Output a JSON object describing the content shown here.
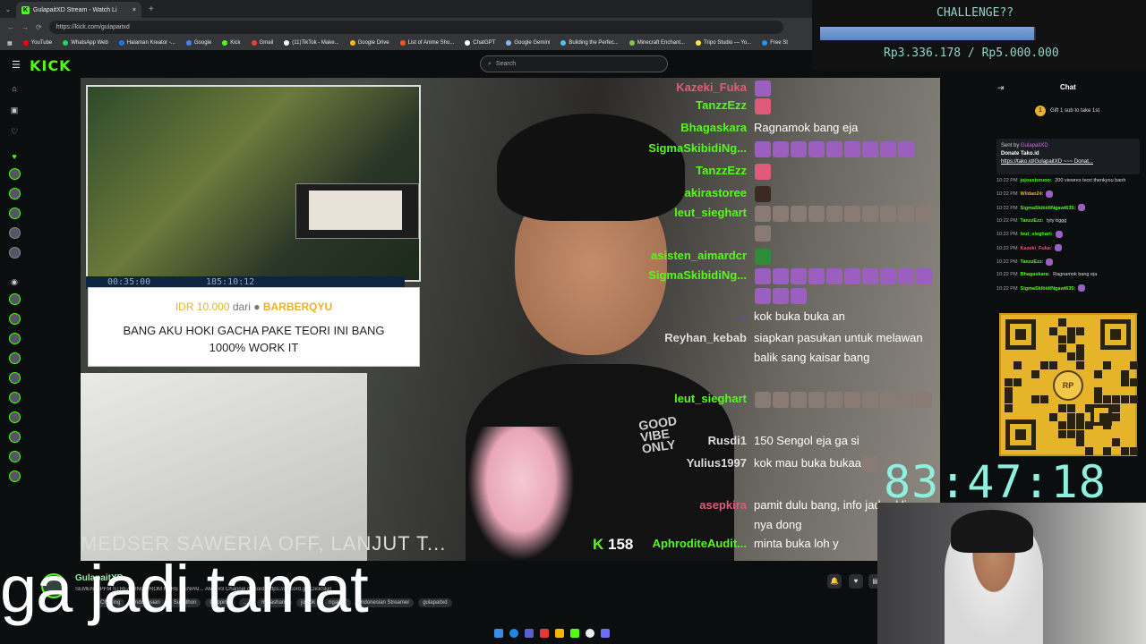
{
  "browser": {
    "tab_title": "GulapaitXD Stream - Watch Li",
    "url": "https://kick.com/gulapaitxd",
    "bookmarks": [
      {
        "label": "YouTube",
        "color": "#ff0000"
      },
      {
        "label": "WhatsApp Web",
        "color": "#25d366"
      },
      {
        "label": "Halaman Kreator -...",
        "color": "#1877f2"
      },
      {
        "label": "Google",
        "color": "#4285f4"
      },
      {
        "label": "Kick",
        "color": "#53fc18"
      },
      {
        "label": "Gmail",
        "color": "#ea4335"
      },
      {
        "label": "(11)TikTok - Make...",
        "color": "#ffffff"
      },
      {
        "label": "Google Drive",
        "color": "#fbbc04"
      },
      {
        "label": "List of Anime Sho...",
        "color": "#ff5722"
      },
      {
        "label": "ChatGPT",
        "color": "#ffffff"
      },
      {
        "label": "Google Gemini",
        "color": "#8ab4f8"
      },
      {
        "label": "Building the Perfec...",
        "color": "#4fc3f7"
      },
      {
        "label": "Minecraft Enchant...",
        "color": "#8bc34a"
      },
      {
        "label": "Tripo Studio — Yo...",
        "color": "#ffeb3b"
      },
      {
        "label": "Free St",
        "color": "#2196f3"
      }
    ]
  },
  "kick": {
    "logo": "KICK",
    "search_placeholder": "Search"
  },
  "challenge": {
    "title": "CHALLENGE??",
    "progress": 0.667,
    "value_text": "Rp3.336.178 / Rp5.000.000"
  },
  "video": {
    "timer_left": "00:35:00",
    "timer_right": "185:10:12",
    "donation": {
      "amount": "IDR 10.000",
      "from": "dari",
      "donor": "BARBERQYU",
      "message": "BANG AKU HOKI GACHA PAKE TEORI INI BANG 1000% WORK IT"
    },
    "shirt_text": "GOOD VIBE ONLY",
    "ticker": "MEDSER SAWERIA OFF, LANJUT T...",
    "viewer_count": "158",
    "overlay_chat": [
      {
        "name": "Kazeki_Fuka",
        "name_color": "#e05a7a",
        "msg": "",
        "emotes": 1,
        "emote_type": "purple"
      },
      {
        "name": "TanzzEzz",
        "name_color": "#53fc18",
        "msg": "",
        "emotes": 1,
        "emote_type": "heart"
      },
      {
        "name": "Bhagaskara",
        "name_color": "#53fc18",
        "msg": "Ragnamok bang eja",
        "emotes": 0
      },
      {
        "name": "SigmaSkibidiNg...",
        "name_color": "#53fc18",
        "msg": "",
        "emotes": 9,
        "emote_type": "purple"
      },
      {
        "name": "TanzzEzz",
        "name_color": "#53fc18",
        "msg": "",
        "emotes": 1,
        "emote_type": "heart"
      },
      {
        "name": "akirastoree",
        "name_color": "#53fc18",
        "msg": "",
        "emotes": 1,
        "emote_type": "dark"
      },
      {
        "name": "leut_sieghart",
        "name_color": "#53fc18",
        "msg": "",
        "emotes": 11,
        "emote_type": "face"
      },
      {
        "name": "asisten_aimardcr",
        "name_color": "#53fc18",
        "msg": "",
        "emotes": 1,
        "emote_type": "green"
      },
      {
        "name": "SigmaSkibidiNg...",
        "name_color": "#53fc18",
        "msg": "",
        "emotes": 13,
        "emote_type": "purple"
      },
      {
        "name": "...",
        "name_color": "#3355cc",
        "msg": "kok buka buka an",
        "emotes": 0
      },
      {
        "name": "Reyhan_kebab",
        "name_color": "#dddddd",
        "msg": "siapkan pasukan untuk melawan balik sang kaisar bang",
        "emotes": 0
      },
      {
        "name": "leut_sieghart",
        "name_color": "#53fc18",
        "msg": "",
        "emotes": 10,
        "emote_type": "face"
      },
      {
        "name": "Rusdi1",
        "name_color": "#dddddd",
        "msg": "150 Sengol eja ga si",
        "emotes": 0
      },
      {
        "name": "Yulius1997",
        "name_color": "#dddddd",
        "msg": "kok mau buka bukaa",
        "emotes": 1,
        "emote_type": "face"
      },
      {
        "name": "asepkira",
        "name_color": "#e05a7a",
        "msg": "pamit dulu bang, info jadwal live nya dong",
        "emotes": 0
      },
      {
        "name": "AphroditeAudit...",
        "name_color": "#53fc18",
        "msg": "minta buka loh y",
        "emotes": 0
      }
    ]
  },
  "subtitle": "ga jadi tamat",
  "stream_info": {
    "streamer": "GulapaitXD",
    "title": "SEMEN GPFM STREAMING FROM HERE SENPAI... AMB #3 Channel discord: https://discord.gg/ClickSkill",
    "tags": [
      "Chatting",
      "Indonesian",
      "Subathon",
      "Gapping",
      "...",
      "malashank",
      "jomok",
      "ngakak",
      "Indonesian Streamer",
      "gulapaitxd"
    ]
  },
  "chat": {
    "title": "Chat",
    "gift_text": "Gift 1 sub to take 1st",
    "pinned": {
      "sent_by_label": "Sent by",
      "sent_by": "GulapaitXD",
      "heading": "Donate Tako.id",
      "link": "https://tako.id/GulapaitXD ~~~ Donat..."
    },
    "messages": [
      {
        "time": "10:22 PM",
        "name": "jojosstoruoo",
        "name_color": "#53fc18",
        "text": "200 viewres teori thenkyou banh"
      },
      {
        "time": "10:22 PM",
        "name": "Wildan24",
        "name_color": "#e8b32a",
        "text": ""
      },
      {
        "time": "10:22 PM",
        "name": "SigmaSkibidiNgawi635",
        "name_color": "#53fc18",
        "text": ""
      },
      {
        "time": "10:22 PM",
        "name": "TanzzEzz",
        "name_color": "#53fc18",
        "text": "tyty bggg"
      },
      {
        "time": "10:22 PM",
        "name": "leut_sieghart",
        "name_color": "#53fc18",
        "text": ""
      },
      {
        "time": "10:22 PM",
        "name": "Kazeki_Fuka",
        "name_color": "#e05a7a",
        "text": ""
      },
      {
        "time": "10:22 PM",
        "name": "TanzzEzz",
        "name_color": "#53fc18",
        "text": ""
      },
      {
        "time": "10:22 PM",
        "name": "Bhagaskara",
        "name_color": "#53fc18",
        "text": "Ragnamok bang eja"
      },
      {
        "time": "10:22 PM",
        "name": "SigmaSkibidiNgawi635",
        "name_color": "#53fc18",
        "text": ""
      }
    ]
  },
  "qr": {
    "badge": "RP"
  },
  "big_timer": "83:47:18"
}
